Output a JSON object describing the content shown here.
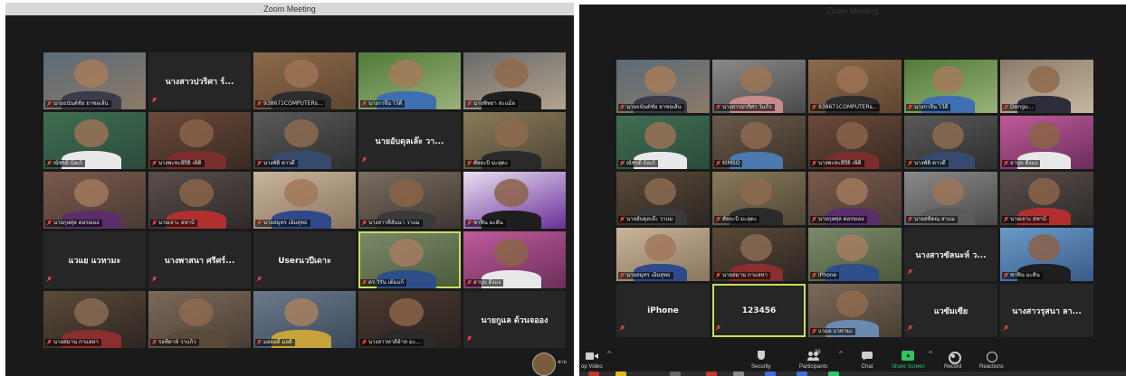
{
  "left_window": {
    "title": "Zoom Meeting",
    "tiles": [
      {
        "type": "video",
        "name": "นายธนันต์ชัย ยาซอเส้น",
        "c1": "#5a6b7a",
        "c2": "#8c7a66",
        "skin": "#a67b5b",
        "shirt": "#3b3b4a"
      },
      {
        "type": "name",
        "center": "นางสาวปวริศา ร์..."
      },
      {
        "type": "video",
        "name": "938671COMPUTERs...",
        "c1": "#8c6a4a",
        "c2": "#5e4632",
        "skin": "#9c7254",
        "shirt": "#2d2d2d"
      },
      {
        "type": "video",
        "name": "นางกาจีน ไว้ดี",
        "c1": "#4f7a3a",
        "c2": "#9ab27a",
        "skin": "#a57a5c",
        "shirt": "#3e6fb0"
      },
      {
        "type": "video",
        "name": "นายพิทยา สะแม้ล",
        "c1": "#6a6a6a",
        "c2": "#b4a48e",
        "skin": "#8f6a4c",
        "shirt": "#1f1f1f"
      },
      {
        "type": "video",
        "name": "ณัชรด้ บ้อเก้",
        "c1": "#3f6e52",
        "c2": "#2d4a3a",
        "skin": "#9a7255",
        "shirt": "#e8e8e8"
      },
      {
        "type": "video",
        "name": "นางพะหะอิปิยิ เพ็ดิ",
        "c1": "#6a4a3a",
        "c2": "#3a2a22",
        "skin": "#8a6248",
        "shirt": "#7a2e2e"
      },
      {
        "type": "video",
        "name": "นางพัติ ดาวดี",
        "c1": "#5a5a5a",
        "c2": "#2e2e2e",
        "skin": "#8c6a50",
        "shirt": "#364a6e"
      },
      {
        "type": "name",
        "center": "นายอับดุลเล๊ะ วา..."
      },
      {
        "type": "video",
        "name": "ศัลยะบิ มะลุดะ",
        "c1": "#8a7a5a",
        "c2": "#4e4636",
        "skin": "#8e6a4e",
        "shirt": "#2a2a2a"
      },
      {
        "type": "video",
        "name": "นายกุลศุล ดอรอเผง",
        "c1": "#7a5a4a",
        "c2": "#4a3a36",
        "skin": "#a0785a",
        "shirt": "#5a2e6a"
      },
      {
        "type": "video",
        "name": "นายเจาะ สหาบ้",
        "c1": "#5a4e4a",
        "c2": "#2e2a2a",
        "skin": "#8a644a",
        "shirt": "#b03030"
      },
      {
        "type": "video",
        "name": "นายสมุทร เอ็มสุทธ",
        "c1": "#c8b49a",
        "c2": "#8a7660",
        "skin": "#a2785a",
        "shirt": "#2e4a8a"
      },
      {
        "type": "video",
        "name": "นางสาวซีฮันนา วาแม",
        "c1": "#7a6e62",
        "c2": "#3e3630",
        "skin": "#8a6448",
        "shirt": "#3a3a3a"
      },
      {
        "type": "video",
        "name": "ซาฟิน มะดิน",
        "c1": "#e8e0f0",
        "c2": "#6a2e9a",
        "skin": "#8c6248",
        "shirt": "#1e1e1e"
      },
      {
        "type": "name",
        "center": "แวแย แวหามะ"
      },
      {
        "type": "name",
        "center": "นางพาสนา ศรีศร์..."
      },
      {
        "type": "name",
        "center": "Userแวปีเดาะ"
      },
      {
        "type": "video",
        "name": "ดร.วิรัน เต้มแก้",
        "c1": "#7a8a6a",
        "c2": "#4a5a3a",
        "skin": "#a47c60",
        "shirt": "#2e4e8a",
        "active": true
      },
      {
        "type": "video",
        "name": "อาบุบ ตีงแง",
        "c1": "#c05a9a",
        "c2": "#6a2e5a",
        "skin": "#8a6448",
        "shirt": "#e8e8e8"
      },
      {
        "type": "video",
        "name": "นายสมาน กาแลหา",
        "c1": "#5a4a3a",
        "c2": "#2e2622",
        "skin": "#8a6a50",
        "shirt": "#8a2e2e"
      },
      {
        "type": "video",
        "name": "รอซีดาห์ วาแก้ว",
        "c1": "#7a6a5a",
        "c2": "#4a3e34",
        "skin": "#8e6a4e",
        "shirt": "#5a4a3a"
      },
      {
        "type": "video",
        "name": "มอยอดี มอดิ",
        "c1": "#6a7a8a",
        "c2": "#3a4a5a",
        "skin": "#a4805e",
        "shirt": "#c8a23a"
      },
      {
        "type": "video",
        "name": "นางสาวหาติฮ้าห มะ...",
        "c1": "#4a3a30",
        "c2": "#2a2220",
        "skin": "#8a6448",
        "shirt": "#2a2a2a"
      },
      {
        "type": "name",
        "center": "นายกูแล ด้วนจออง"
      }
    ]
  },
  "right_window": {
    "title": "Zoom Meeting",
    "tiles": [
      {
        "type": "video",
        "name": "นายธนันต์ชัย ยาซอเส้น",
        "c1": "#5a6b7a",
        "c2": "#8c7a66",
        "skin": "#a67b5b",
        "shirt": "#3b3b4a"
      },
      {
        "type": "video",
        "name": "นางสาวปวริศา ว์แก้ว",
        "c1": "#8a8a8a",
        "c2": "#4a4a4a",
        "skin": "#9c7456",
        "shirt": "#c88a8a"
      },
      {
        "type": "video",
        "name": "938671COMPUTERs...",
        "c1": "#8c6a4a",
        "c2": "#5e4632",
        "skin": "#9c7254",
        "shirt": "#2d2d2d"
      },
      {
        "type": "video",
        "name": "นางกาจีน ไว้ดี",
        "c1": "#4f7a3a",
        "c2": "#9ab27a",
        "skin": "#a57a5c",
        "shirt": "#3e6fb0"
      },
      {
        "type": "video",
        "name": "Dongu...",
        "c1": "#8a7a6a",
        "c2": "#c8b8a0",
        "skin": "#8f6a4c",
        "shirt": "#2e2e3a"
      },
      {
        "type": "video",
        "name": "ณัชรด้ บ้อเก้",
        "c1": "#3f6e52",
        "c2": "#2d4a3a",
        "skin": "#9a7255",
        "shirt": "#e8e8e8"
      },
      {
        "type": "video",
        "name": "KIMSO",
        "c1": "#6a5a4a",
        "c2": "#3a322a",
        "skin": "#8c6a4e",
        "shirt": "#4a7ab0"
      },
      {
        "type": "video",
        "name": "นางพะหะอิปิยิ เพ็ดิ",
        "c1": "#6a4a3a",
        "c2": "#3a2a22",
        "skin": "#8a6248",
        "shirt": "#7a2e2e"
      },
      {
        "type": "video",
        "name": "นางพัติ ดาวดี",
        "c1": "#5a5a5a",
        "c2": "#2e2e2e",
        "skin": "#8c6a50",
        "shirt": "#364a6e"
      },
      {
        "type": "video",
        "name": "อาบุบ ตีงแง",
        "c1": "#c05a9a",
        "c2": "#6a2e5a",
        "skin": "#8a6448",
        "shirt": "#e8e8e8"
      },
      {
        "type": "video",
        "name": "นายอับดุลเล๊ะ วาแม",
        "c1": "#5a4a3a",
        "c2": "#2e2622",
        "skin": "#8a6a50",
        "shirt": "#3a3a3a"
      },
      {
        "type": "video",
        "name": "ศัลยะบิ มะลุดะ",
        "c1": "#8a7a5a",
        "c2": "#4e4636",
        "skin": "#8e6a4e",
        "shirt": "#2a2a2a"
      },
      {
        "type": "video",
        "name": "นายกุลศุล ดอรอเผง",
        "c1": "#7a5a4a",
        "c2": "#4a3a36",
        "skin": "#a0785a",
        "shirt": "#5a2e6a"
      },
      {
        "type": "video",
        "name": "นายสหิตณ สาแม",
        "c1": "#8a8a8a",
        "c2": "#4a4a4a",
        "skin": "#9a7456",
        "shirt": "#5a5a5a"
      },
      {
        "type": "video",
        "name": "นายเจาะ สหาบ้",
        "c1": "#5a4e4a",
        "c2": "#2e2a2a",
        "skin": "#8a644a",
        "shirt": "#b03030"
      },
      {
        "type": "video",
        "name": "นายสมุทร เอ็มสุทธ",
        "c1": "#c8b49a",
        "c2": "#8a7660",
        "skin": "#a2785a",
        "shirt": "#2e4a8a"
      },
      {
        "type": "video",
        "name": "นายสมาน กาแลหา",
        "c1": "#5a4a3a",
        "c2": "#2e2622",
        "skin": "#8a6a50",
        "shirt": "#8a2e2e"
      },
      {
        "type": "video",
        "name": "iPhone",
        "c1": "#7a8a6a",
        "c2": "#4a5a3a",
        "skin": "#a47c60",
        "shirt": "#2e4e8a"
      },
      {
        "type": "name",
        "center": "นางสาวซัลนะห์ ว..."
      },
      {
        "type": "video",
        "name": "ซาฟิน มะดิน",
        "c1": "#6a9ac8",
        "c2": "#3a5a8a",
        "skin": "#8c6248",
        "shirt": "#1e1e1e"
      },
      {
        "type": "name",
        "center": "iPhone"
      },
      {
        "type": "name",
        "center": "123456",
        "active": true
      },
      {
        "type": "video",
        "name": "แวแย แวหามะ",
        "c1": "#7a6a5a",
        "c2": "#4a3e34",
        "skin": "#8e6a4e",
        "shirt": "#6a8ab0"
      },
      {
        "type": "name",
        "center": "แวซัมเซีย"
      },
      {
        "type": "name",
        "center": "นางสาวรุสนา ลา..."
      }
    ],
    "toolbar": {
      "stop_video": "op Video",
      "security": "Security",
      "participants": "Participants",
      "participants_count": "36",
      "chat": "Chat",
      "share_screen": "Share Screen",
      "record": "Record",
      "reactions": "Reactions"
    },
    "colors": {
      "share": "#2ec566",
      "active_speaker": "#c8e05a",
      "mute": "#e0413c"
    }
  },
  "self_view": {
    "name": "ฟาน่"
  }
}
